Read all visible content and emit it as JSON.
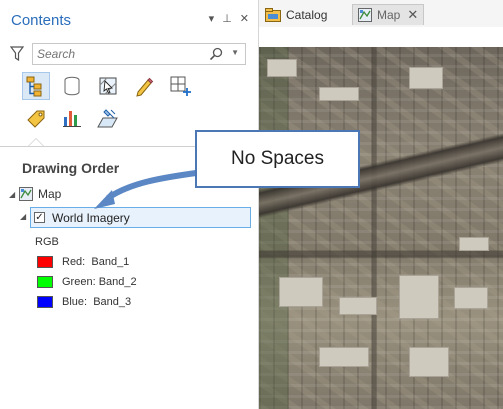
{
  "contents_pane": {
    "title": "Contents",
    "controls": [
      "▾",
      "⊥",
      "✕"
    ],
    "search": {
      "placeholder": "Search",
      "value": ""
    },
    "toolbar": [
      {
        "name": "list-by-drawing-order",
        "icon": "tree-icon",
        "active": true
      },
      {
        "name": "list-by-source",
        "icon": "database-icon",
        "active": false
      },
      {
        "name": "list-by-selection",
        "icon": "selection-icon",
        "active": false
      },
      {
        "name": "list-by-editing",
        "icon": "pencil-icon",
        "active": false
      },
      {
        "name": "list-by-snapping",
        "icon": "snapping-icon",
        "active": false
      },
      {
        "name": "list-by-labeling",
        "icon": "label-tag-icon",
        "active": false
      },
      {
        "name": "list-by-charts",
        "icon": "chart-icon",
        "active": false
      },
      {
        "name": "list-by-perspective",
        "icon": "perspective-icon",
        "active": false
      }
    ],
    "section_title": "Drawing Order",
    "map_node": {
      "label": "Map"
    },
    "layer": {
      "label": "World Imagery",
      "checked": true
    },
    "renderer_label": "RGB",
    "bands": [
      {
        "channel": "Red:",
        "band": "Band_1",
        "color": "#ff0000"
      },
      {
        "channel": "Green:",
        "band": "Band_2",
        "color": "#00ff00"
      },
      {
        "channel": "Blue:",
        "band": "Band_3",
        "color": "#0000ff"
      }
    ]
  },
  "tabs": [
    {
      "label": "Catalog",
      "icon": "catalog-icon",
      "active": false,
      "closable": false
    },
    {
      "label": "Map",
      "icon": "map-icon",
      "active": true,
      "closable": true
    }
  ],
  "callout": {
    "text": "No Spaces"
  },
  "colors": {
    "accent": "#2a6ebb",
    "callout_border": "#4b77b5",
    "selection": "#e8f2fc"
  }
}
